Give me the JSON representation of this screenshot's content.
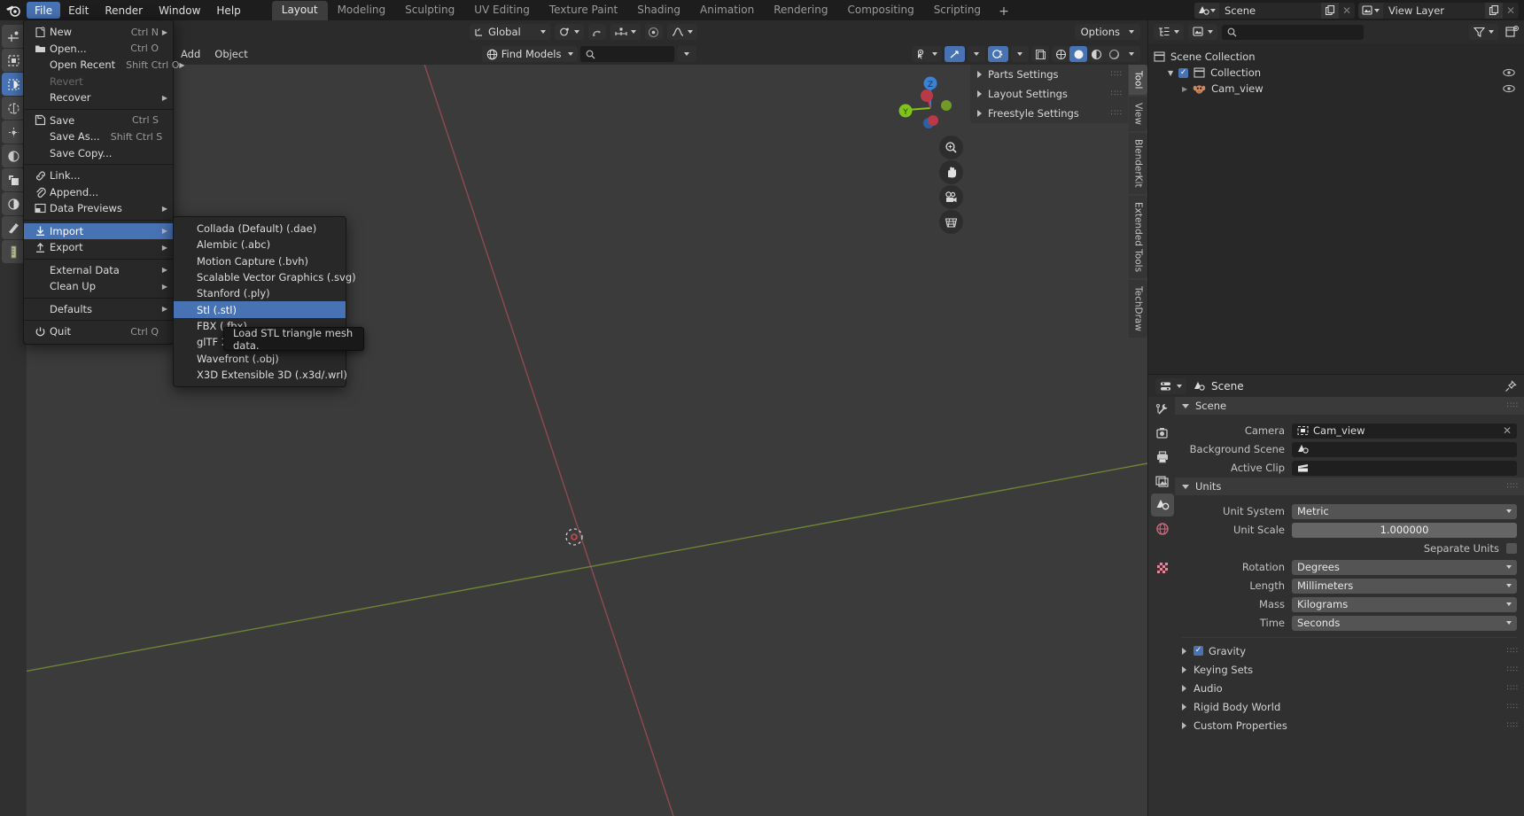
{
  "topbar": {
    "menus": [
      "File",
      "Edit",
      "Render",
      "Window",
      "Help"
    ],
    "active_menu": "File",
    "workspaces": [
      "Layout",
      "Modeling",
      "Sculpting",
      "UV Editing",
      "Texture Paint",
      "Shading",
      "Animation",
      "Rendering",
      "Compositing",
      "Scripting"
    ],
    "active_workspace": "Layout",
    "add_workspace": "+",
    "scene_name": "Scene",
    "viewlayer_name": "View Layer"
  },
  "file_menu": {
    "items": [
      {
        "label": "New",
        "shortcut": "Ctrl N",
        "arrow": true,
        "icon": "new-file-icon",
        "disabled": false
      },
      {
        "label": "Open...",
        "shortcut": "Ctrl O",
        "arrow": false,
        "icon": "folder-icon",
        "disabled": false
      },
      {
        "label": "Open Recent",
        "shortcut": "Shift Ctrl O",
        "arrow": true,
        "icon": "",
        "disabled": false
      },
      {
        "label": "Revert",
        "shortcut": "",
        "arrow": false,
        "icon": "",
        "disabled": true
      },
      {
        "label": "Recover",
        "shortcut": "",
        "arrow": true,
        "icon": "",
        "disabled": false
      },
      {
        "sep": true
      },
      {
        "label": "Save",
        "shortcut": "Ctrl S",
        "arrow": false,
        "icon": "save-icon",
        "disabled": false
      },
      {
        "label": "Save As...",
        "shortcut": "Shift Ctrl S",
        "arrow": false,
        "icon": "",
        "disabled": false
      },
      {
        "label": "Save Copy...",
        "shortcut": "",
        "arrow": false,
        "icon": "",
        "disabled": false
      },
      {
        "sep": true
      },
      {
        "label": "Link...",
        "shortcut": "",
        "arrow": false,
        "icon": "link-icon",
        "disabled": false
      },
      {
        "label": "Append...",
        "shortcut": "",
        "arrow": false,
        "icon": "paperclip-icon",
        "disabled": false
      },
      {
        "label": "Data Previews",
        "shortcut": "",
        "arrow": true,
        "icon": "image-icon",
        "disabled": false
      },
      {
        "sep": true
      },
      {
        "label": "Import",
        "shortcut": "",
        "arrow": true,
        "icon": "import-icon",
        "disabled": false,
        "highlight": true
      },
      {
        "label": "Export",
        "shortcut": "",
        "arrow": true,
        "icon": "export-icon",
        "disabled": false
      },
      {
        "sep": true
      },
      {
        "label": "External Data",
        "shortcut": "",
        "arrow": true,
        "icon": "",
        "disabled": false
      },
      {
        "label": "Clean Up",
        "shortcut": "",
        "arrow": true,
        "icon": "",
        "disabled": false
      },
      {
        "sep": true
      },
      {
        "label": "Defaults",
        "shortcut": "",
        "arrow": true,
        "icon": "",
        "disabled": false
      },
      {
        "sep": true
      },
      {
        "label": "Quit",
        "shortcut": "Ctrl Q",
        "arrow": false,
        "icon": "power-icon",
        "disabled": false
      }
    ]
  },
  "import_submenu": {
    "items": [
      {
        "label": "Collada (Default) (.dae)",
        "highlight": false
      },
      {
        "label": "Alembic (.abc)",
        "highlight": false
      },
      {
        "label": "Motion Capture (.bvh)",
        "highlight": false
      },
      {
        "label": "Scalable Vector Graphics (.svg)",
        "highlight": false
      },
      {
        "label": "Stanford (.ply)",
        "highlight": false
      },
      {
        "label": "Stl (.stl)",
        "highlight": true
      },
      {
        "label": "FBX (.fbx)",
        "highlight": false
      },
      {
        "label": "glTF 2.0 (.glb/.gltf)",
        "highlight": false
      },
      {
        "label": "Wavefront (.obj)",
        "highlight": false
      },
      {
        "label": "X3D Extensible 3D (.x3d/.wrl)",
        "highlight": false
      }
    ],
    "tooltip": "Load STL triangle mesh data."
  },
  "viewport_header": {
    "add_label": "Add",
    "object_label": "Object",
    "transform_orientation": "Global",
    "options_label": "Options",
    "find_models_label": "Find Models",
    "find_models_search_value": ""
  },
  "side_panel": {
    "items": [
      "Parts Settings",
      "Layout Settings",
      "Freestyle Settings"
    ]
  },
  "viewport_tabs": [
    "Tool",
    "View",
    "BlenderKit",
    "Extended Tools",
    "TechDraw"
  ],
  "outliner": {
    "search_value": "",
    "rows": [
      {
        "label": "Scene Collection",
        "indent": 0,
        "icon": "collection-icon",
        "checkbox": false,
        "eye": false
      },
      {
        "label": "Collection",
        "indent": 1,
        "icon": "collection-icon",
        "checkbox": true,
        "eye": true
      },
      {
        "label": "Cam_view",
        "indent": 2,
        "icon": "monkey-icon",
        "checkbox": false,
        "eye": true
      }
    ]
  },
  "properties": {
    "breadcrumb": "Scene",
    "sections": [
      {
        "title": "Scene",
        "expanded": true,
        "rows": [
          {
            "label": "Camera",
            "type": "field",
            "value": "Cam_view",
            "icon": "camera-icon",
            "close": true
          },
          {
            "label": "Background Scene",
            "type": "field",
            "value": "",
            "icon": "scene-icon",
            "close": false
          },
          {
            "label": "Active Clip",
            "type": "field",
            "value": "",
            "icon": "clip-icon",
            "close": false
          }
        ]
      },
      {
        "title": "Units",
        "expanded": true,
        "rows": [
          {
            "label": "Unit System",
            "type": "select",
            "value": "Metric"
          },
          {
            "label": "Unit Scale",
            "type": "number",
            "value": "1.000000"
          },
          {
            "label": "Separate Units",
            "type": "checkbox",
            "value": ""
          },
          {
            "label": "Rotation",
            "type": "select",
            "value": "Degrees"
          },
          {
            "label": "Length",
            "type": "select",
            "value": "Millimeters"
          },
          {
            "label": "Mass",
            "type": "select",
            "value": "Kilograms"
          },
          {
            "label": "Time",
            "type": "select",
            "value": "Seconds"
          }
        ]
      }
    ],
    "collapsed": [
      {
        "label": "Gravity",
        "checkbox": true
      },
      {
        "label": "Keying Sets",
        "checkbox": false
      },
      {
        "label": "Audio",
        "checkbox": false
      },
      {
        "label": "Rigid Body World",
        "checkbox": false
      },
      {
        "label": "Custom Properties",
        "checkbox": false
      }
    ]
  },
  "colors": {
    "accent": "#4772b3",
    "axis_x": "#c0394b",
    "axis_y": "#8fb84a",
    "panel_bg": "#303030",
    "viewport_bg": "#3b3b3b"
  }
}
